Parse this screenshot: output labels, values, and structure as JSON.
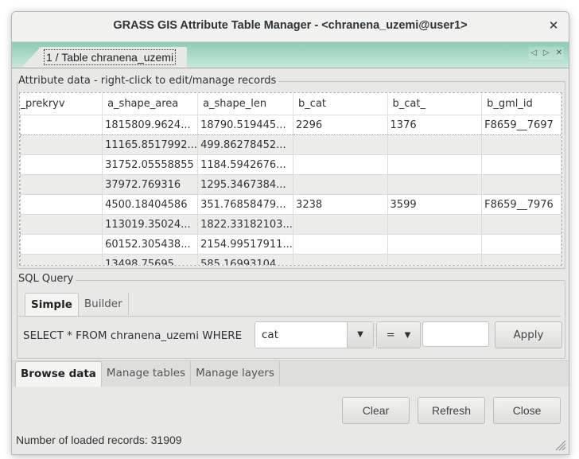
{
  "window": {
    "title": "GRASS GIS Attribute Table Manager - <chranena_uzemi@user1>",
    "close_icon": "close-icon"
  },
  "notebook": {
    "tab_label": "1 / Table chranena_uzemi",
    "controls": {
      "prev": "◁",
      "next": "▷",
      "close": "✕"
    }
  },
  "attribute_data": {
    "group_label": "Attribute data - right-click to edit/manage records",
    "columns": [
      "_prekryv",
      "a_shape_area",
      "a_shape_len",
      "b_cat",
      "b_cat_",
      "b_gml_id"
    ],
    "rows": [
      [
        "",
        "1815809.9624...",
        "18790.519445...",
        "2296",
        "1376",
        "F8659__7697"
      ],
      [
        "",
        "11165.8517992...",
        "499.86278452...",
        "",
        "",
        ""
      ],
      [
        "",
        "31752.05558855",
        "1184.5942676...",
        "",
        "",
        ""
      ],
      [
        "",
        "37972.769316",
        "1295.3467384...",
        "",
        "",
        ""
      ],
      [
        "",
        "4500.18404586",
        "351.76858479...",
        "3238",
        "3599",
        "F8659__7976"
      ],
      [
        "",
        "113019.35024...",
        "1822.33182103...",
        "",
        "",
        ""
      ],
      [
        "",
        "60152.305438...",
        "2154.99517911...",
        "",
        "",
        ""
      ],
      [
        "",
        "13498.75695",
        "585.16993104...",
        "",
        "",
        ""
      ]
    ]
  },
  "sql_query": {
    "group_label": "SQL Query",
    "tabs": [
      {
        "label": "Simple",
        "active": true
      },
      {
        "label": "Builder",
        "active": false
      }
    ],
    "prefix": "SELECT * FROM chranena_uzemi WHERE",
    "column_select": "cat",
    "operator_select": "=",
    "value_input": "",
    "apply_label": "Apply",
    "dropdown_caret": "▼"
  },
  "main_tabs": [
    {
      "label": "Browse data",
      "active": true
    },
    {
      "label": "Manage tables",
      "active": false
    },
    {
      "label": "Manage layers",
      "active": false
    }
  ],
  "buttons": {
    "clear": "Clear",
    "refresh": "Refresh",
    "close": "Close"
  },
  "status": {
    "text": "Number of loaded records: 31909"
  }
}
